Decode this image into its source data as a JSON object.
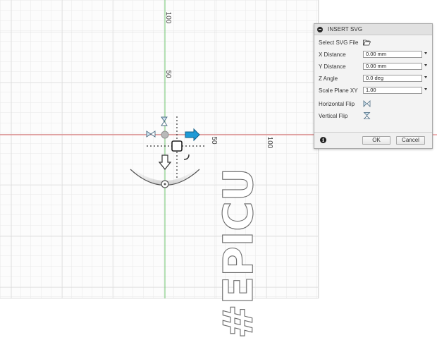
{
  "canvas": {
    "axis_labels": {
      "v100": "100",
      "v50": "50",
      "h50": "50",
      "h100": "100"
    },
    "sketch_text": "#EPICU",
    "colors": {
      "background": "#ffffff",
      "grid": "#e3e3e3",
      "x_axis": "#e06a6a",
      "y_axis": "#6cc46c",
      "manipulator_arrow": "#1e9ad6"
    }
  },
  "dialog": {
    "title": "INSERT SVG",
    "select_label": "Select SVG File",
    "fields": [
      {
        "label": "X Distance",
        "value": "0.00 mm"
      },
      {
        "label": "Y Distance",
        "value": "0.00 mm"
      },
      {
        "label": "Z Angle",
        "value": "0.0 deg"
      },
      {
        "label": "Scale Plane XY",
        "value": "1.00"
      }
    ],
    "horizontal_flip_label": "Horizontal Flip",
    "vertical_flip_label": "Vertical Flip",
    "ok_label": "OK",
    "cancel_label": "Cancel"
  }
}
